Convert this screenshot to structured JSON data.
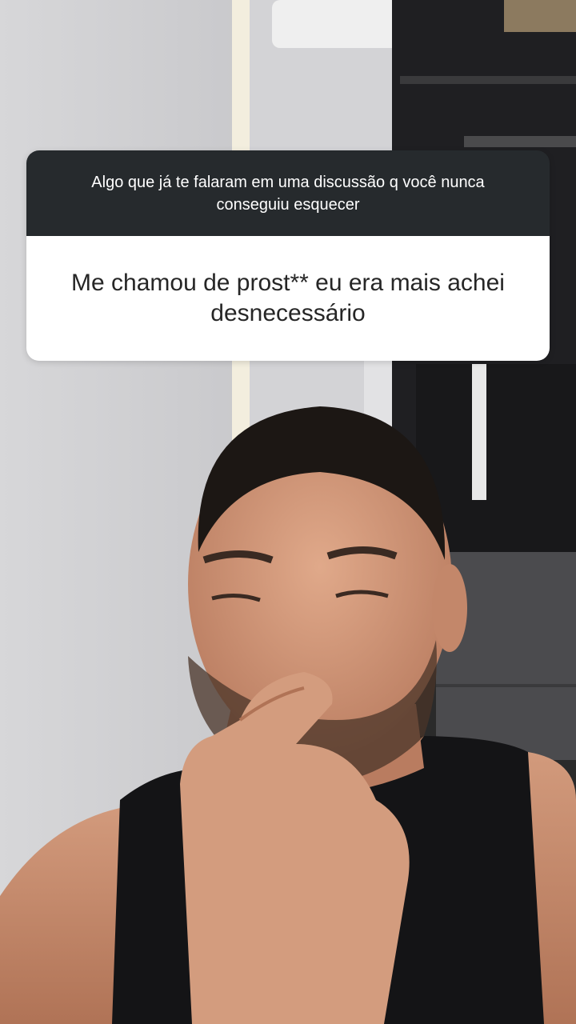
{
  "question_sticker": {
    "question": "Algo que já te falaram em uma discussão q você nunca conseguiu esquecer",
    "answer": "Me chamou de prost** eu era mais achei desnecessário",
    "header_color": "#262a2d",
    "answer_bg_color": "#ffffff"
  }
}
